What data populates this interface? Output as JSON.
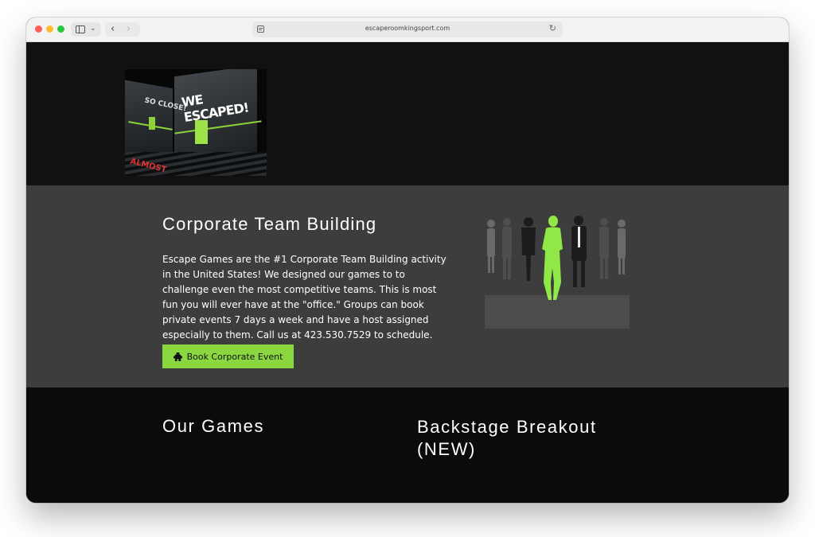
{
  "browser": {
    "url": "escaperoomkingsport.com",
    "colors": {
      "close": "#fe5f57",
      "minimize": "#febc2e",
      "maximize": "#28c840"
    }
  },
  "hero": {
    "logo": {
      "headline": "WE ESCAPED!",
      "secondary": "SO CLOSE!",
      "footer": "ALMOST"
    }
  },
  "corporate": {
    "title": "Corporate Team Building",
    "description": "Escape Games are the #1 Corporate Team Building activity in the United States! We designed our games to to challenge even the most competitive teams. This is most fun you will ever have at the \"office.\" Groups can book private events 7 days a week and have a host assigned especially to them.  Call us at 423.530.7529 to schedule.",
    "button_label": "Book Corporate Event",
    "button_icon": "puzzle-piece-icon",
    "image": "business-team-silhouettes",
    "accent_color": "#8bd73f"
  },
  "games": {
    "title": "Our Games",
    "featured_title": "Backstage Breakout (NEW)"
  }
}
